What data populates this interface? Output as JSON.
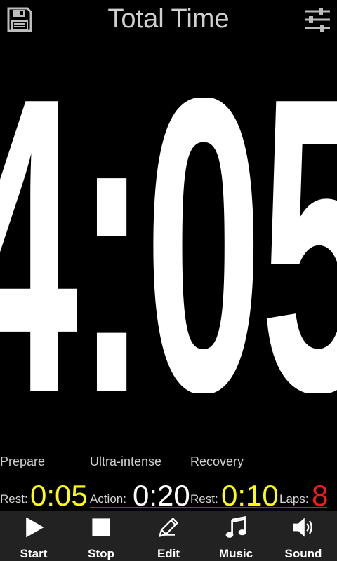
{
  "header": {
    "title": "Total Time",
    "save_icon": "save-icon",
    "settings_icon": "sliders-icon"
  },
  "timer": {
    "display": "4:05"
  },
  "phases": {
    "labels": [
      "Prepare",
      "Ultra-intense",
      "Recovery"
    ],
    "items": [
      {
        "label": "Rest:",
        "value": "0:05",
        "color": "#ffff00"
      },
      {
        "label": "Action:",
        "value": "0:20",
        "color": "#ffffff"
      },
      {
        "label": "Rest:",
        "value": "0:10",
        "color": "#ffff00"
      },
      {
        "label": "Laps:",
        "value": "8",
        "color": "#ff1a1a"
      }
    ]
  },
  "toolbar": {
    "start": "Start",
    "stop": "Stop",
    "edit": "Edit",
    "music": "Music",
    "sound": "Sound"
  }
}
